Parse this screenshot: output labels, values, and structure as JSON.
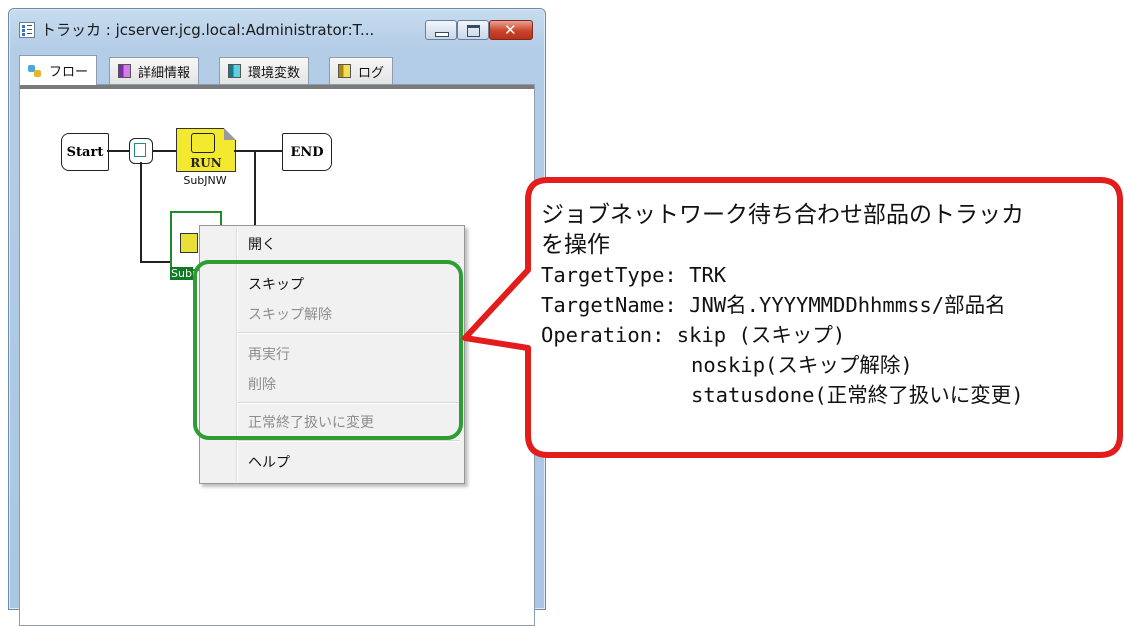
{
  "window": {
    "title": "トラッカ : jcserver.jcg.local:Administrator:T...",
    "close_glyph": "✕"
  },
  "tabs": [
    {
      "label": "フロー",
      "icon": "flow-icon"
    },
    {
      "label": "詳細情報",
      "icon": "details-icon"
    },
    {
      "label": "環境変数",
      "icon": "env-vars-icon"
    },
    {
      "label": "ログ",
      "icon": "log-icon"
    }
  ],
  "flow": {
    "start_label": "Start",
    "end_label": "END",
    "run_label": "RUN",
    "subjnw_label": "SubJNW",
    "sub_tag": "Sub"
  },
  "context_menu": {
    "items": [
      {
        "label": "開く",
        "enabled": true
      },
      {
        "label": "スキップ",
        "enabled": true
      },
      {
        "label": "スキップ解除",
        "enabled": false
      },
      {
        "label": "再実行",
        "enabled": false
      },
      {
        "label": "削除",
        "enabled": false
      },
      {
        "label": "正常終了扱いに変更",
        "enabled": false
      },
      {
        "label": "ヘルプ",
        "enabled": true
      }
    ]
  },
  "callout": {
    "line1": "ジョブネットワーク待ち合わせ部品のトラッカ",
    "line2": "を操作",
    "line3": "TargetType: TRK",
    "line4": "TargetName: JNW名.YYYYMMDDhhmmss/部品名",
    "line5": "Operation: skip (スキップ)",
    "line6": "noskip(スキップ解除)",
    "line7": "statusdone(正常終了扱いに変更)"
  },
  "colors": {
    "callout_border": "#e31c1c",
    "highlight_border": "#2d9d34",
    "close_button": "#c9442b"
  }
}
